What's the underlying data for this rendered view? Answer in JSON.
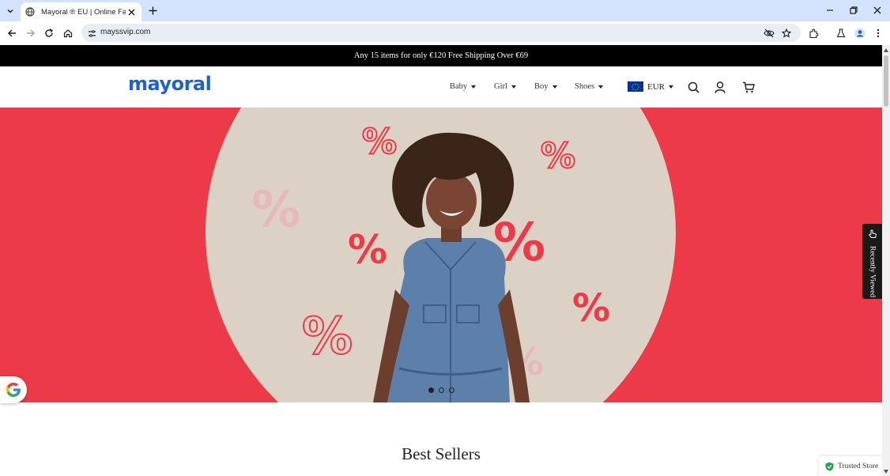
{
  "browser": {
    "tab_title": "Mayoral ® EU | Online Fashion",
    "url": "mayssvip.com"
  },
  "announcement": "Any 15 items for only €120 Free Shipping Over €69",
  "site": {
    "logo_text": "mayoral",
    "nav": [
      "Baby",
      "Girl",
      "Boy",
      "Shoes"
    ],
    "currency": "EUR",
    "brand_color": "#1e63c6",
    "hero_color": "#ec3a48"
  },
  "hero": {
    "slide_count": 3,
    "active_slide": 1
  },
  "section_title": "Best Sellers",
  "recently_viewed": "Recently Viewed",
  "trusted_store": "Trusted Store"
}
